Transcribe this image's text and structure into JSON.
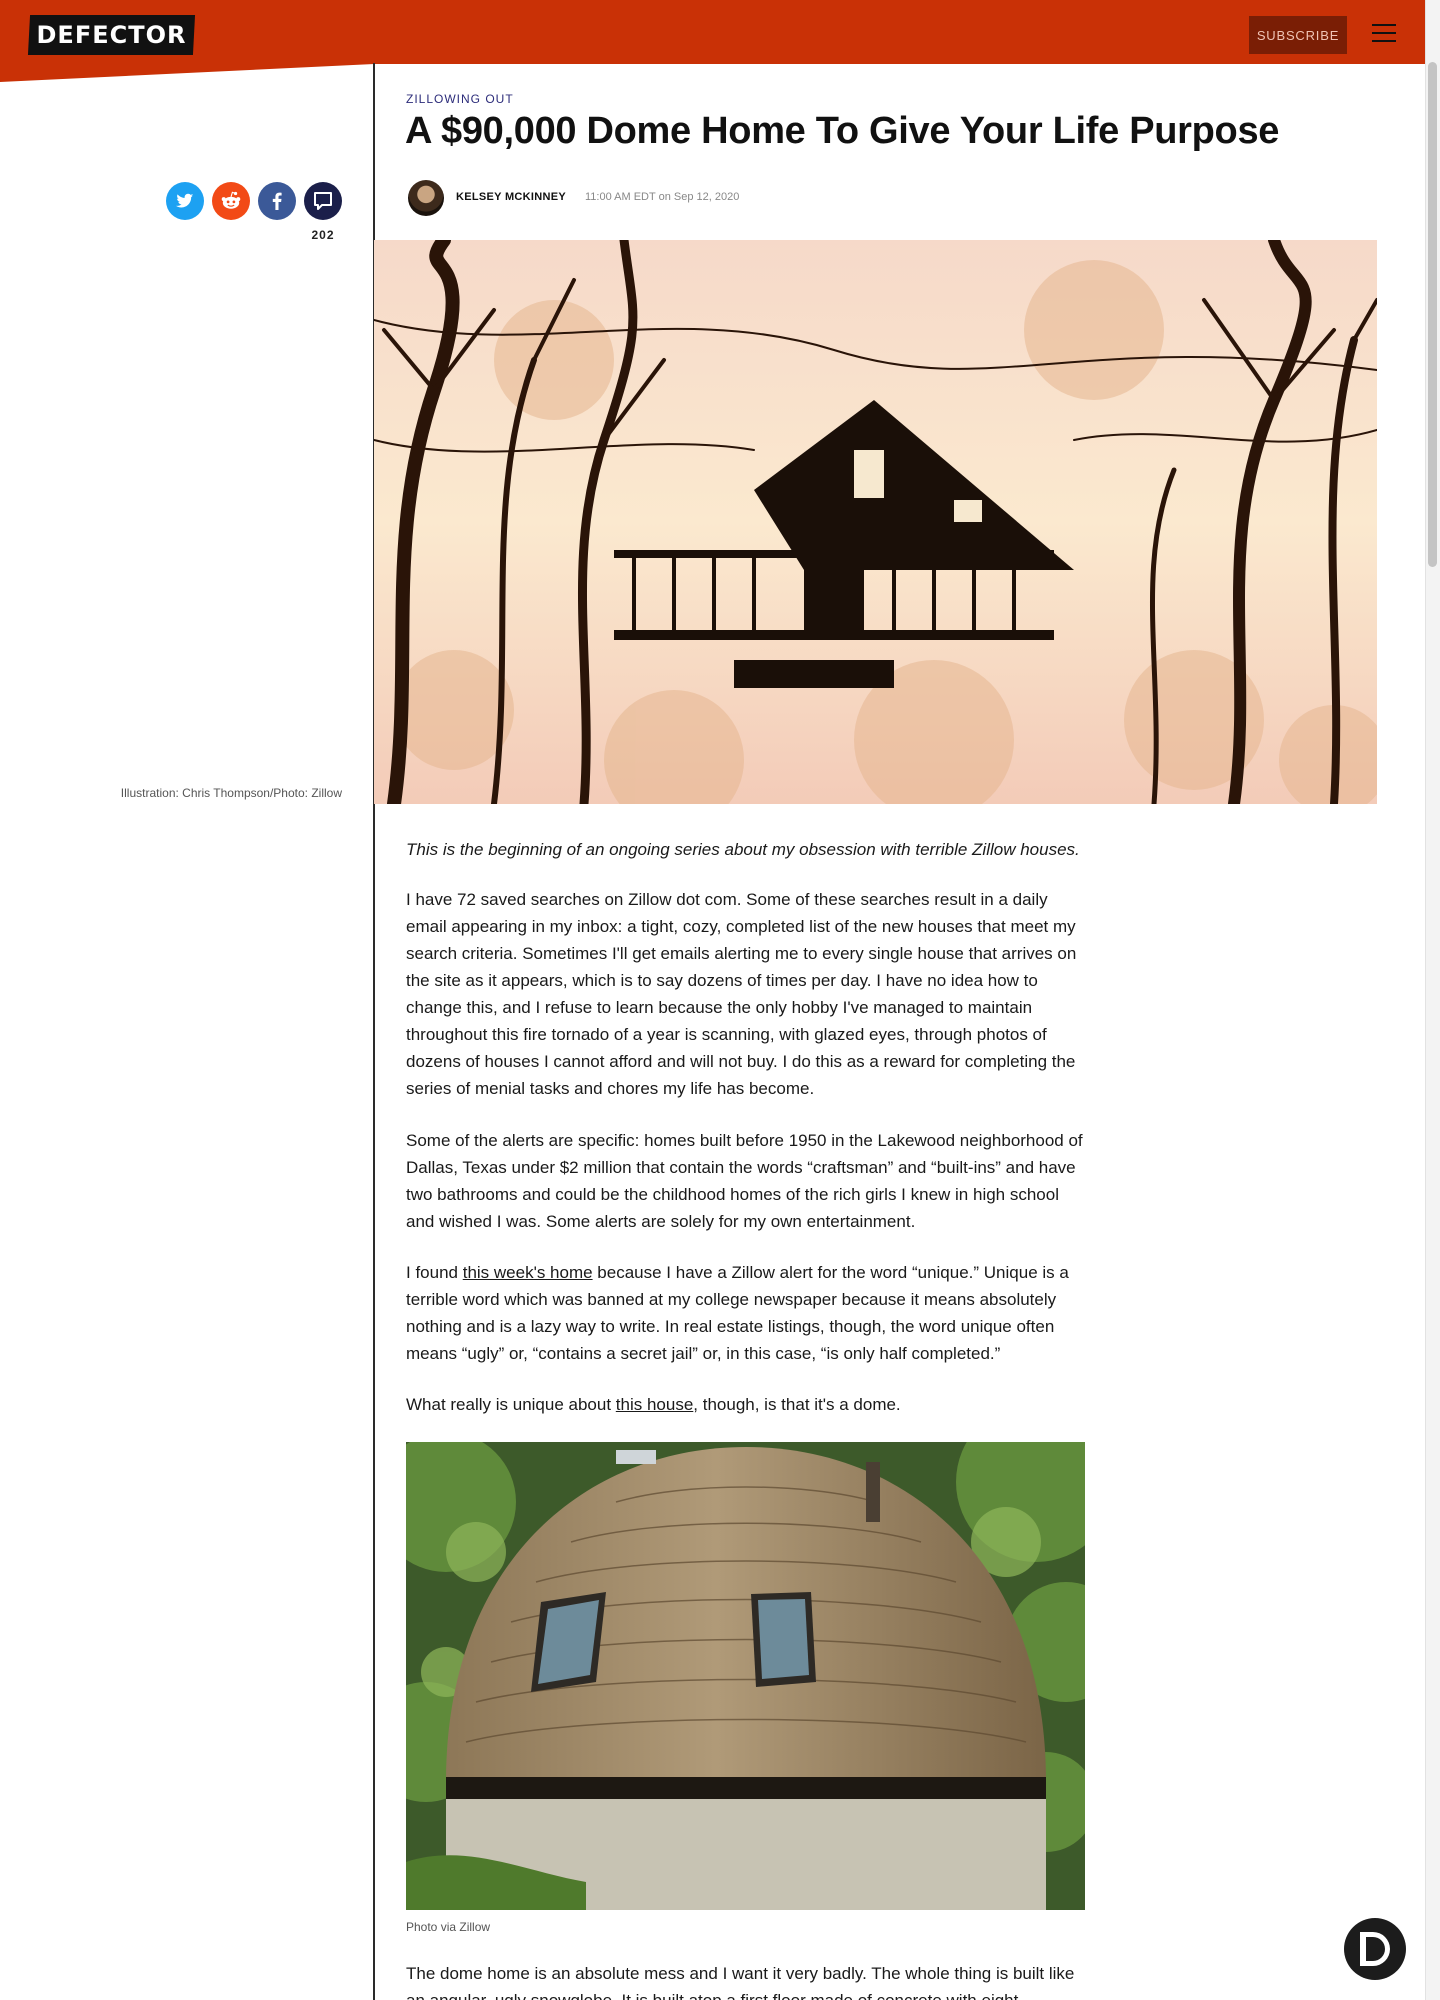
{
  "header": {
    "logo": "DEFECTOR",
    "subscribe_label": "SUBSCRIBE",
    "menu_icon": "hamburger-icon",
    "brand_color": "#c93106"
  },
  "share": {
    "icons": [
      "twitter-icon",
      "reddit-icon",
      "facebook-icon",
      "comment-icon"
    ],
    "comment_count": "202"
  },
  "article": {
    "kicker": "ZILLOWING OUT",
    "title": "A $90,000 Dome Home To Give Your Life Purpose",
    "author": "KELSEY MCKINNEY",
    "date": "11:00 AM EDT on Sep 12, 2020",
    "hero_credit": "Illustration: Chris Thompson/Photo: Zillow",
    "intro": "This is the beginning of an ongoing series about my obsession with terrible Zillow houses.",
    "p1": "I have 72 saved searches on Zillow dot com. Some of these searches result in a daily email appearing in my inbox: a tight, cozy, completed list of the new houses that meet my search criteria. Sometimes I'll get emails alerting me to every single house that arrives on the site as it appears, which is to say dozens of times per day. I have no idea how to change this, and I refuse to learn because the only hobby I've managed to maintain throughout this fire tornado of a year is scanning, with glazed eyes, through photos of dozens of houses I cannot afford and will not buy. I do this as a reward for completing the series of menial tasks and chores my life has become.",
    "p2": "Some of the alerts are specific: homes built before 1950 in the Lakewood neighborhood of Dallas, Texas under $2 million that contain the words “craftsman” and “built-ins” and have two bathrooms and could be the childhood homes of the rich girls I knew in high school and wished I was. Some alerts are solely for my own entertainment.",
    "p3": {
      "pre": "I found ",
      "link": "this week's home",
      "post": " because I have a Zillow alert for the word “unique.” Unique is a terrible word which was banned at my college newspaper because it means absolutely nothing and is a lazy way to write. In real estate listings, though, the word unique often means “ugly” or, “contains a secret jail” or, in this case, “is only half completed.”"
    },
    "p4": {
      "pre": "What really is unique about ",
      "link": "this house",
      "post": ", though, is that it's a dome."
    },
    "photo_caption": "Photo via Zillow",
    "p5": "The dome home is an absolute mess and I want it very badly. The whole thing is built like an angular, ugly snowglobe. It is built atop a first floor made of concrete with eight"
  }
}
